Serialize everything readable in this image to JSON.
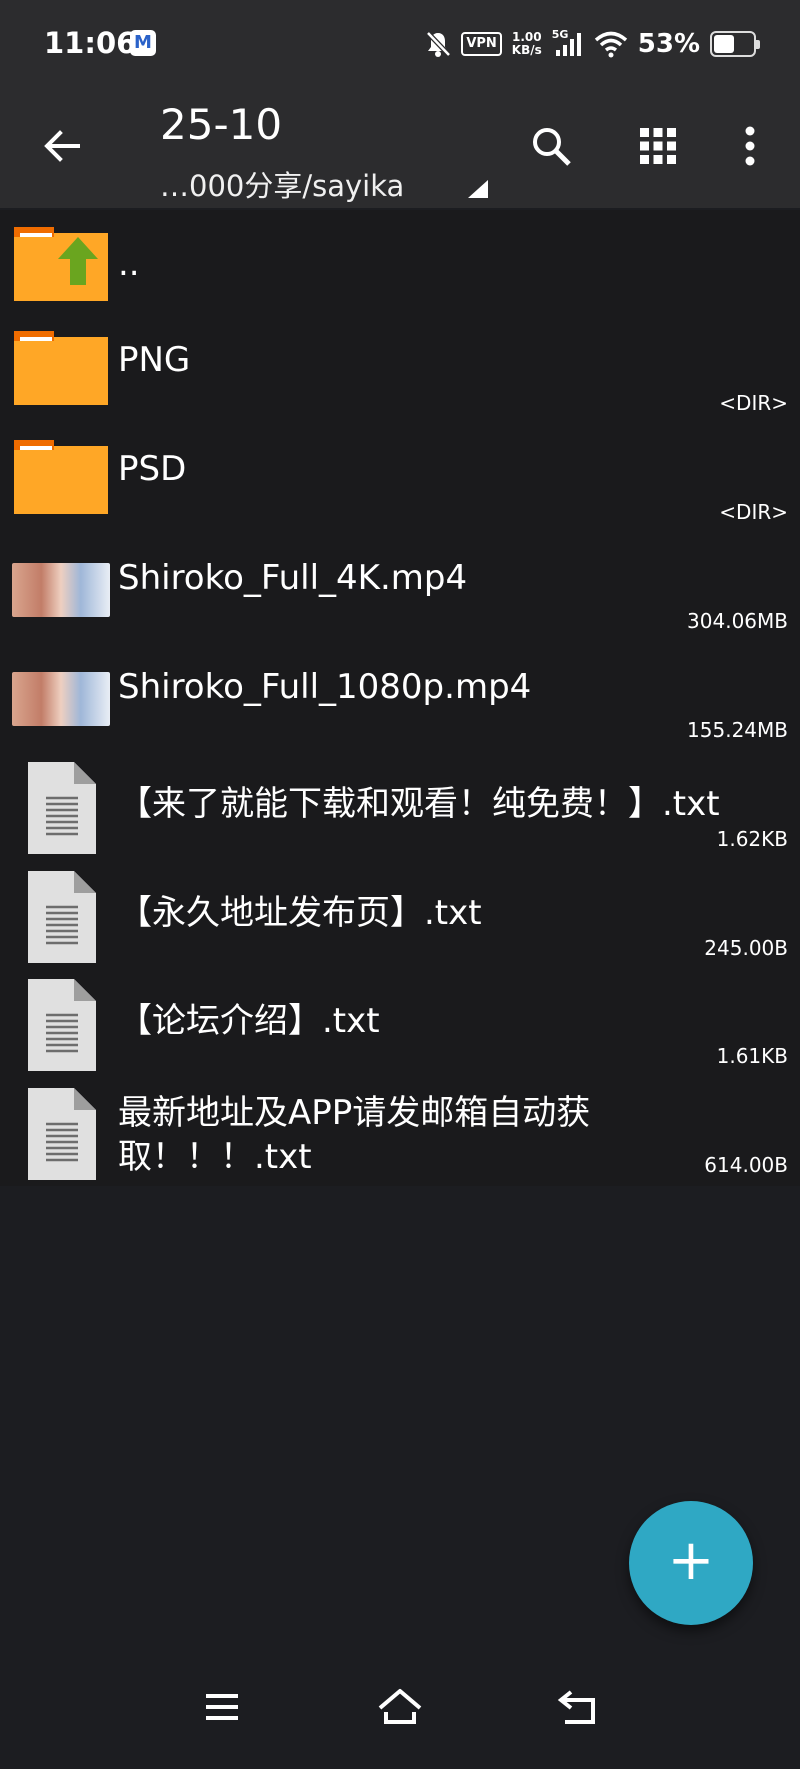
{
  "status_bar": {
    "time": "11:06",
    "mail_icon_letter": "M",
    "vpn_label": "VPN",
    "net_speed_value": "1.00",
    "net_speed_unit": "KB/s",
    "signal_label": "5G",
    "battery_percent": "53%",
    "battery_level": 0.53
  },
  "toolbar": {
    "title": "25-10",
    "path": "…000分享/sayika",
    "icons": [
      "back-arrow-icon",
      "search-icon",
      "grid-view-icon",
      "more-vert-icon"
    ]
  },
  "files": [
    {
      "name": "..",
      "size": "",
      "type": "parent-folder"
    },
    {
      "name": "PNG",
      "size": "<DIR>",
      "type": "folder"
    },
    {
      "name": "PSD",
      "size": "<DIR>",
      "type": "folder"
    },
    {
      "name": "Shiroko_Full_4K.mp4",
      "size": "304.06MB",
      "type": "video"
    },
    {
      "name": "Shiroko_Full_1080p.mp4",
      "size": "155.24MB",
      "type": "video"
    },
    {
      "name": "【来了就能下载和观看！纯免费！】.txt",
      "size": "1.62KB",
      "type": "text"
    },
    {
      "name": "【永久地址发布页】.txt",
      "size": "245.00B",
      "type": "text"
    },
    {
      "name": "【论坛介绍】.txt",
      "size": "1.61KB",
      "type": "text"
    },
    {
      "name_line1": "最新地址及APP请发邮箱自动获",
      "name_line2": "取！！！.txt",
      "size": "614.00B",
      "type": "text"
    }
  ],
  "fab": {
    "label": "+",
    "color": "#2fa8c4"
  },
  "colors": {
    "folder": "#ffa726",
    "folder_tab": "#ef6c00",
    "up_arrow": "#6aa51f",
    "background": "#1c1d21",
    "toolbar": "#2c2c2e"
  }
}
